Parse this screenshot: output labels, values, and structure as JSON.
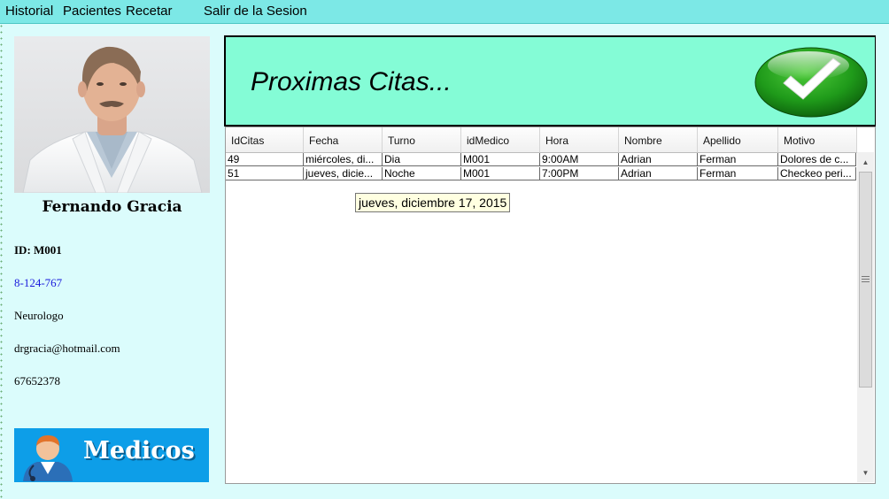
{
  "menu": {
    "items": [
      "Historial",
      "Pacientes",
      "Recetar"
    ],
    "logout": "Salir de la Sesion"
  },
  "doctor": {
    "name": "Fernando Gracia",
    "id_label": "ID:  M001",
    "phone": "8-124-767",
    "specialty": "Neurologo",
    "email": "drgracia@hotmail.com",
    "mobile": "67652378"
  },
  "banner": {
    "label": "Medicos"
  },
  "header": {
    "title": "Proximas Citas..."
  },
  "grid": {
    "columns": [
      "IdCitas",
      "Fecha",
      "Turno",
      "idMedico",
      "Hora",
      "Nombre",
      "Apellido",
      "Motivo"
    ],
    "rows": [
      [
        "49",
        "miércoles, di...",
        "Dia",
        "M001",
        "9:00AM",
        "Adrian",
        "Ferman",
        "Dolores de c..."
      ],
      [
        "51",
        "jueves, dicie...",
        "Noche",
        "M001",
        "7:00PM",
        "Adrian",
        "Ferman",
        "Checkeo peri..."
      ]
    ]
  },
  "tooltip": {
    "text": "jueves, diciembre 17, 2015"
  },
  "colors": {
    "menu_bg": "#7ce8e6",
    "panel_bg": "#dbfcfc",
    "header_bg": "#84fcd6",
    "banner_bg": "#0d9ee8",
    "phone_text": "#1a1adc"
  }
}
